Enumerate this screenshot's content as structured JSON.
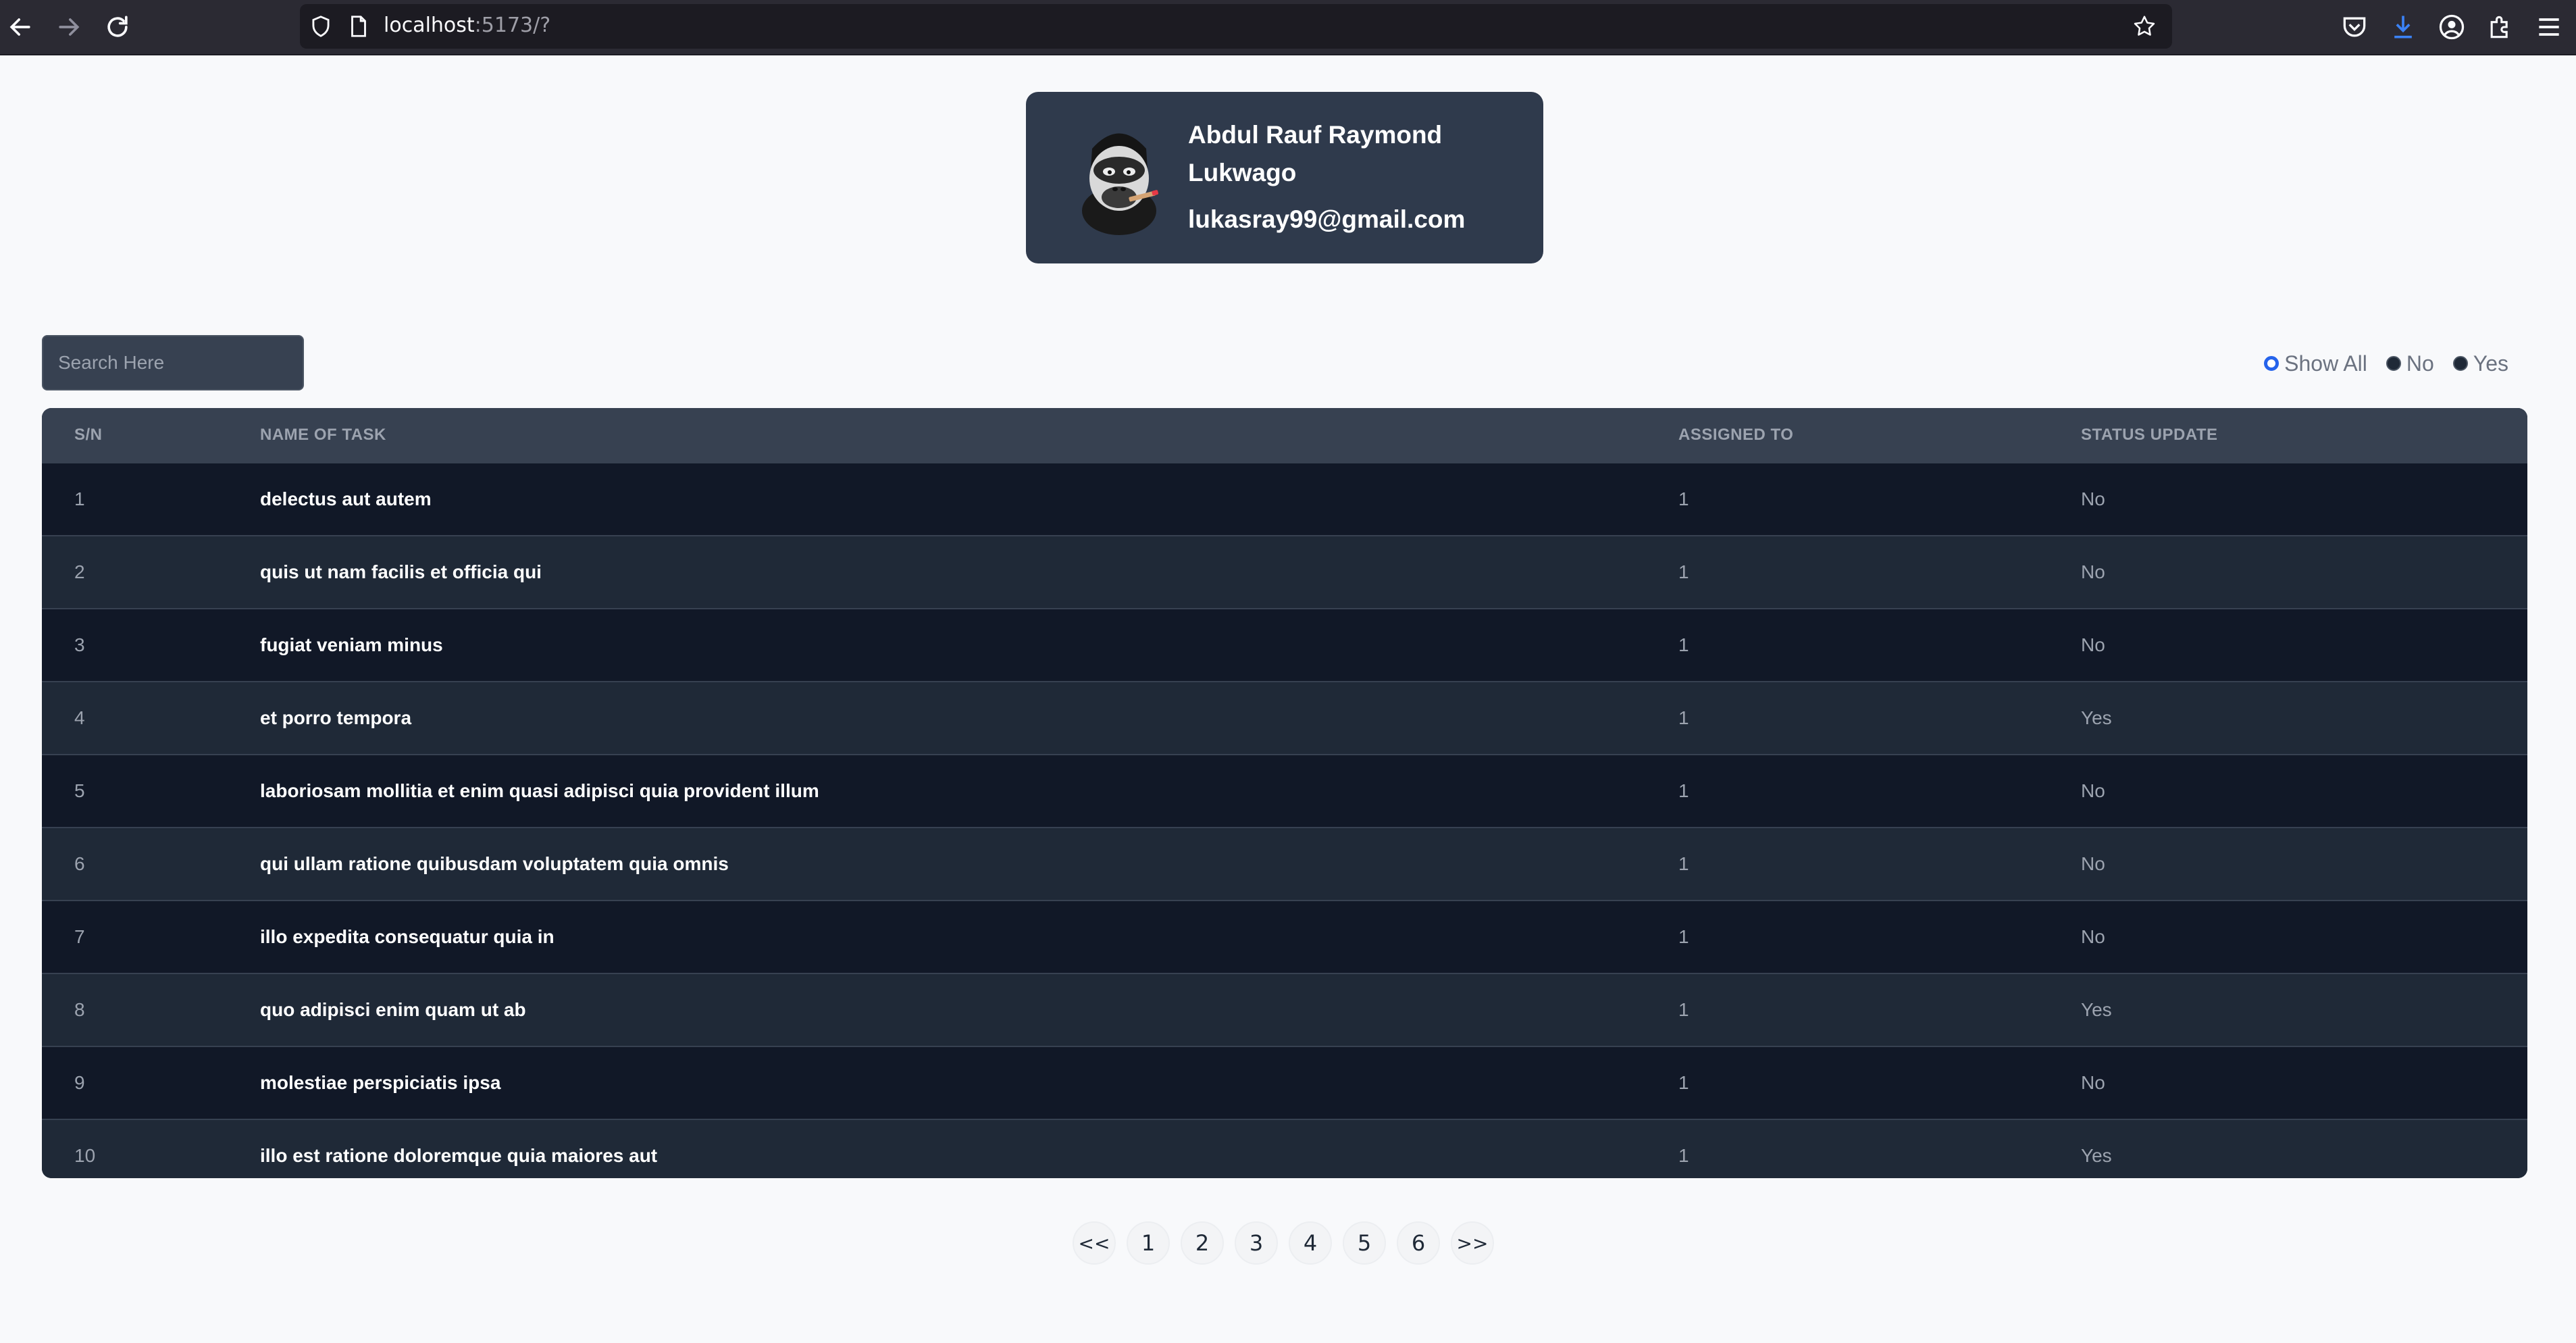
{
  "browser": {
    "url_host": "localhost",
    "url_rest": ":5173/?"
  },
  "profile": {
    "name": "Abdul Rauf Raymond Lukwago",
    "email": "lukasray99@gmail.com"
  },
  "search": {
    "placeholder": "Search Here",
    "value": ""
  },
  "filters": {
    "options": [
      "Show All",
      "No",
      "Yes"
    ],
    "selected": "Show All"
  },
  "table": {
    "headers": [
      "S/N",
      "NAME OF TASK",
      "ASSIGNED TO",
      "STATUS UPDATE"
    ],
    "rows": [
      {
        "sn": "1",
        "task": "delectus aut autem",
        "assigned": "1",
        "status": "No"
      },
      {
        "sn": "2",
        "task": "quis ut nam facilis et officia qui",
        "assigned": "1",
        "status": "No"
      },
      {
        "sn": "3",
        "task": "fugiat veniam minus",
        "assigned": "1",
        "status": "No"
      },
      {
        "sn": "4",
        "task": "et porro tempora",
        "assigned": "1",
        "status": "Yes"
      },
      {
        "sn": "5",
        "task": "laboriosam mollitia et enim quasi adipisci quia provident illum",
        "assigned": "1",
        "status": "No"
      },
      {
        "sn": "6",
        "task": "qui ullam ratione quibusdam voluptatem quia omnis",
        "assigned": "1",
        "status": "No"
      },
      {
        "sn": "7",
        "task": "illo expedita consequatur quia in",
        "assigned": "1",
        "status": "No"
      },
      {
        "sn": "8",
        "task": "quo adipisci enim quam ut ab",
        "assigned": "1",
        "status": "Yes"
      },
      {
        "sn": "9",
        "task": "molestiae perspiciatis ipsa",
        "assigned": "1",
        "status": "No"
      },
      {
        "sn": "10",
        "task": "illo est ratione doloremque quia maiores aut",
        "assigned": "1",
        "status": "Yes"
      }
    ]
  },
  "pagination": {
    "prev": "<<",
    "pages": [
      "1",
      "2",
      "3",
      "4",
      "5",
      "6"
    ],
    "next": ">>"
  },
  "colors": {
    "accent": "#2563eb",
    "card": "#2f3a4c",
    "table_header": "#374151",
    "row_dark": "#111827",
    "row_light": "#1f2937"
  }
}
